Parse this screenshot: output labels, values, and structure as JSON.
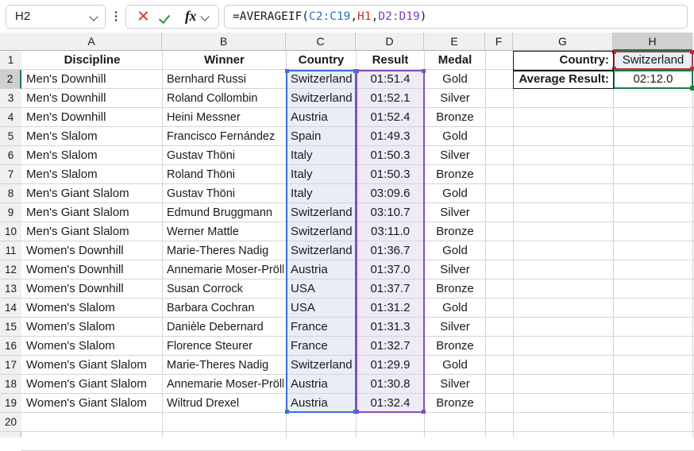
{
  "app": {
    "name_box_value": "H2",
    "formula": {
      "full": "=AVERAGEIF(C2:C19,H1,D2:D19)",
      "prefix": "=AVERAGEIF(",
      "ref1": "C2:C19",
      "sep1": ",",
      "ref2": "H1",
      "sep2": ",",
      "ref3": "D2:D19",
      "suffix": ")"
    },
    "icons": {
      "name_box_dropdown": "chevron-down-icon",
      "kebab": "more-options-icon",
      "cancel": "cancel-x-icon",
      "accept": "accept-check-icon",
      "function": "fx-icon",
      "function_dropdown": "chevron-down-icon"
    }
  },
  "colors": {
    "ref_blue": "#3b6fd4",
    "ref_red": "#b5323c",
    "ref_purple": "#7d52c0",
    "selection_green": "#1e7a45",
    "highlight_blue_fill": "#e8edf7",
    "highlight_purple_fill": "#efeaf7",
    "header_bg": "#f0f0f0",
    "header_selected_bg": "#d0d0d0",
    "gridline": "#d4d4d4"
  },
  "columns": [
    {
      "id": "A",
      "label": "A"
    },
    {
      "id": "B",
      "label": "B"
    },
    {
      "id": "C",
      "label": "C"
    },
    {
      "id": "D",
      "label": "D"
    },
    {
      "id": "E",
      "label": "E"
    },
    {
      "id": "F",
      "label": "F"
    },
    {
      "id": "G",
      "label": "G"
    },
    {
      "id": "H",
      "label": "H",
      "selected": true
    }
  ],
  "rows": [
    1,
    2,
    3,
    4,
    5,
    6,
    7,
    8,
    9,
    10,
    11,
    12,
    13,
    14,
    15,
    16,
    17,
    18,
    19,
    20
  ],
  "selected_row": 2,
  "table": {
    "headers": [
      "Discipline",
      "Winner",
      "Country",
      "Result",
      "Medal"
    ],
    "data": [
      {
        "row": 2,
        "discipline": "Men's Downhill",
        "winner": "Bernhard Russi",
        "country": "Switzerland",
        "result": "01:51.4",
        "medal": "Gold"
      },
      {
        "row": 3,
        "discipline": "Men's Downhill",
        "winner": "Roland Collombin",
        "country": "Switzerland",
        "result": "01:52.1",
        "medal": "Silver"
      },
      {
        "row": 4,
        "discipline": "Men's Downhill",
        "winner": "Heini Messner",
        "country": "Austria",
        "result": "01:52.4",
        "medal": "Bronze"
      },
      {
        "row": 5,
        "discipline": "Men's Slalom",
        "winner": "Francisco Fernández",
        "country": "Spain",
        "result": "01:49.3",
        "medal": "Gold"
      },
      {
        "row": 6,
        "discipline": "Men's Slalom",
        "winner": "Gustav Thöni",
        "country": "Italy",
        "result": "01:50.3",
        "medal": "Silver"
      },
      {
        "row": 7,
        "discipline": "Men's Slalom",
        "winner": "Roland Thöni",
        "country": "Italy",
        "result": "01:50.3",
        "medal": "Bronze"
      },
      {
        "row": 8,
        "discipline": "Men's Giant Slalom",
        "winner": "Gustav Thöni",
        "country": "Italy",
        "result": "03:09.6",
        "medal": "Gold"
      },
      {
        "row": 9,
        "discipline": "Men's Giant Slalom",
        "winner": "Edmund Bruggmann",
        "country": "Switzerland",
        "result": "03:10.7",
        "medal": "Silver"
      },
      {
        "row": 10,
        "discipline": "Men's Giant Slalom",
        "winner": "Werner Mattle",
        "country": "Switzerland",
        "result": "03:11.0",
        "medal": "Bronze"
      },
      {
        "row": 11,
        "discipline": "Women's Downhill",
        "winner": "Marie-Theres Nadig",
        "country": "Switzerland",
        "result": "01:36.7",
        "medal": "Gold"
      },
      {
        "row": 12,
        "discipline": "Women's Downhill",
        "winner": "Annemarie Moser-Pröll",
        "country": "Austria",
        "result": "01:37.0",
        "medal": "Silver"
      },
      {
        "row": 13,
        "discipline": "Women's Downhill",
        "winner": "Susan Corrock",
        "country": "USA",
        "result": "01:37.7",
        "medal": "Bronze"
      },
      {
        "row": 14,
        "discipline": "Women's Slalom",
        "winner": "Barbara Cochran",
        "country": "USA",
        "result": "01:31.2",
        "medal": "Gold"
      },
      {
        "row": 15,
        "discipline": "Women's Slalom",
        "winner": "Danièle Debernard",
        "country": "France",
        "result": "01:31.3",
        "medal": "Silver"
      },
      {
        "row": 16,
        "discipline": "Women's Slalom",
        "winner": "Florence Steurer",
        "country": "France",
        "result": "01:32.7",
        "medal": "Bronze"
      },
      {
        "row": 17,
        "discipline": "Women's Giant Slalom",
        "winner": "Marie-Theres Nadig",
        "country": "Switzerland",
        "result": "01:29.9",
        "medal": "Gold"
      },
      {
        "row": 18,
        "discipline": "Women's Giant Slalom",
        "winner": "Annemarie Moser-Pröll",
        "country": "Austria",
        "result": "01:30.8",
        "medal": "Silver"
      },
      {
        "row": 19,
        "discipline": "Women's Giant Slalom",
        "winner": "Wiltrud Drexel",
        "country": "Austria",
        "result": "01:32.4",
        "medal": "Bronze"
      }
    ]
  },
  "panel": {
    "country_label": "Country:",
    "country_value": "Switzerland",
    "average_label": "Average Result:",
    "average_value": "02:12.0"
  }
}
